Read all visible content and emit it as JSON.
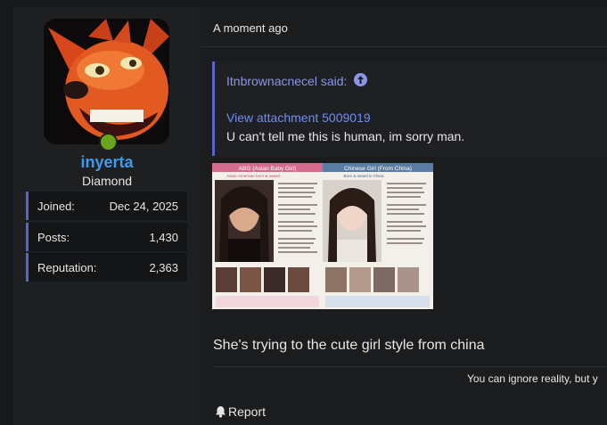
{
  "user": {
    "name": "inyerta",
    "rank": "Diamond",
    "stats": [
      {
        "key": "Joined:",
        "value": "Dec 24, 2025"
      },
      {
        "key": "Posts:",
        "value": "1,430"
      },
      {
        "key": "Reputation:",
        "value": "2,363"
      }
    ]
  },
  "post": {
    "time": "A moment ago",
    "quote": {
      "author_said": "Itnbrownacnecel said:",
      "attachment_link": "View attachment 5009019",
      "text": "U can't tell me this is human, im sorry man."
    },
    "image": {
      "left_header": "ABG (Asian Baby Girl)",
      "left_sub": "Asian-American born & raised",
      "right_header": "Chinese Girl (From China)",
      "right_sub": "Born & raised in China"
    },
    "body": "She's trying to the cute girl style from china",
    "signature": "You can ignore reality, but y",
    "report_label": "Report"
  },
  "colors": {
    "accent": "#5865c8",
    "username": "#3a9cf0",
    "online": "#6aa51c"
  }
}
